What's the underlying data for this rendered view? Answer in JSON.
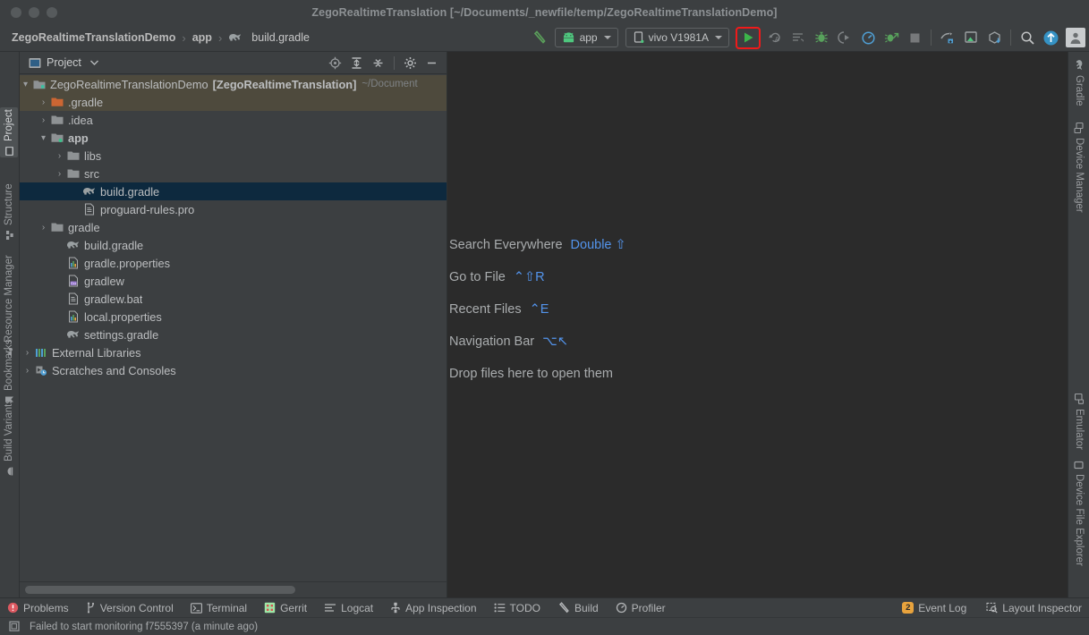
{
  "window": {
    "title": "ZegoRealtimeTranslation [~/Documents/_newfile/temp/ZegoRealtimeTranslationDemo]"
  },
  "breadcrumb": {
    "items": [
      {
        "label": "ZegoRealtimeTranslationDemo",
        "bold": true,
        "icon": ""
      },
      {
        "label": "app",
        "bold": true,
        "icon": ""
      },
      {
        "label": "build.gradle",
        "bold": false,
        "icon": "gradle-elephant-icon"
      }
    ],
    "separator": "›"
  },
  "toolbar": {
    "build_hammer": "build-hammer-icon",
    "module_selector": {
      "label": "app",
      "icon": "android-head-icon"
    },
    "device_selector": {
      "label": "vivo V1981A",
      "icon": "phone-icon"
    },
    "run_button": {
      "label": "Run",
      "icon": "run-play-icon",
      "highlight_color": "#f01a1a",
      "highlighted": true
    },
    "rerun_button": "rerun-icon",
    "apply_changes": "apply-changes-icon",
    "debug_button": "debug-bug-icon",
    "attach_debugger": "attach-debugger-icon",
    "profiler_button": "profiler-gauge-icon",
    "run_with_coverage": "run-coverage-icon",
    "stop_button": "stop-square-icon",
    "sdk_manager": "sdk-manager-icon",
    "avd_manager": "avd-manager-icon",
    "gradle_sync": "gradle-sync-icon",
    "search_button": "search-icon",
    "update_button": "update-arrow-icon",
    "account_button": "user-avatar-icon"
  },
  "left_tool_strip": {
    "top": [
      {
        "label": "Project",
        "icon": "project-icon",
        "active": true
      },
      {
        "label": "Structure",
        "icon": "structure-icon",
        "active": false
      },
      {
        "label": "Resource Manager",
        "icon": "resource-manager-icon",
        "active": false
      }
    ],
    "bottom": [
      {
        "label": "Bookmarks",
        "icon": "bookmark-icon",
        "active": false
      },
      {
        "label": "Build Variants",
        "icon": "build-variants-icon",
        "active": false
      }
    ]
  },
  "right_tool_strip": {
    "top": [
      {
        "label": "Gradle",
        "icon": "gradle-elephant-icon",
        "active": false
      },
      {
        "label": "Device Manager",
        "icon": "device-manager-icon",
        "active": false
      }
    ],
    "bottom": [
      {
        "label": "Emulator",
        "icon": "emulator-icon",
        "active": false
      },
      {
        "label": "Device File Explorer",
        "icon": "device-file-explorer-icon",
        "active": false
      }
    ]
  },
  "project_panel": {
    "title": "Project",
    "title_icon": "project-window-icon",
    "dropdown_icon": "chevron-down-icon",
    "actions": [
      {
        "name": "select-opened-file-icon"
      },
      {
        "name": "expand-all-icon"
      },
      {
        "name": "collapse-all-icon"
      },
      {
        "name": "settings-gear-icon"
      },
      {
        "name": "hide-minimize-icon"
      }
    ],
    "tree": [
      {
        "indent": 0,
        "arrow": "⌄",
        "icon": "module-icon",
        "label": "ZegoRealtimeTranslationDemo",
        "bold": false,
        "suffix_bold": "[ZegoRealtimeTranslation]",
        "suffix_dim": "~/Document",
        "state": "root",
        "squiggle": true
      },
      {
        "indent": 1,
        "arrow": "›",
        "icon": "folder-orange-icon",
        "label": ".gradle",
        "bold": false,
        "state": "highlighted"
      },
      {
        "indent": 1,
        "arrow": "›",
        "icon": "folder-icon",
        "label": ".idea",
        "bold": false,
        "state": "normal"
      },
      {
        "indent": 1,
        "arrow": "⌄",
        "icon": "folder-module-icon",
        "label": "app",
        "bold": true,
        "state": "normal",
        "squiggle": true
      },
      {
        "indent": 2,
        "arrow": "›",
        "icon": "folder-icon",
        "label": "libs",
        "bold": false,
        "state": "normal"
      },
      {
        "indent": 2,
        "arrow": "›",
        "icon": "folder-icon",
        "label": "src",
        "bold": false,
        "state": "normal",
        "squiggle": true
      },
      {
        "indent": 3,
        "arrow": "",
        "icon": "gradle-elephant-icon",
        "label": "build.gradle",
        "bold": false,
        "state": "selected"
      },
      {
        "indent": 3,
        "arrow": "",
        "icon": "text-file-icon",
        "label": "proguard-rules.pro",
        "bold": false,
        "state": "normal"
      },
      {
        "indent": 1,
        "arrow": "›",
        "icon": "folder-icon",
        "label": "gradle",
        "bold": false,
        "state": "normal"
      },
      {
        "indent": 2,
        "arrow": "",
        "icon": "gradle-elephant-icon",
        "label": "build.gradle",
        "bold": false,
        "state": "normal"
      },
      {
        "indent": 2,
        "arrow": "",
        "icon": "properties-file-icon",
        "label": "gradle.properties",
        "bold": false,
        "state": "normal"
      },
      {
        "indent": 2,
        "arrow": "",
        "icon": "shell-script-icon",
        "label": "gradlew",
        "bold": false,
        "state": "normal"
      },
      {
        "indent": 2,
        "arrow": "",
        "icon": "text-file-icon",
        "label": "gradlew.bat",
        "bold": false,
        "state": "normal"
      },
      {
        "indent": 2,
        "arrow": "",
        "icon": "properties-file-icon",
        "label": "local.properties",
        "bold": false,
        "state": "normal"
      },
      {
        "indent": 2,
        "arrow": "",
        "icon": "gradle-elephant-icon",
        "label": "settings.gradle",
        "bold": false,
        "state": "normal"
      },
      {
        "indent": 0,
        "arrow": "›",
        "icon": "external-libraries-icon",
        "label": "External Libraries",
        "bold": false,
        "state": "normal"
      },
      {
        "indent": 0,
        "arrow": "›",
        "icon": "scratches-icon",
        "label": "Scratches and Consoles",
        "bold": false,
        "state": "normal"
      }
    ]
  },
  "editor": {
    "shortcuts": [
      {
        "label": "Search Everywhere",
        "key": "Double ⇧"
      },
      {
        "label": "Go to File",
        "key": "⌃⇧R"
      },
      {
        "label": "Recent Files",
        "key": "⌃E"
      },
      {
        "label": "Navigation Bar",
        "key": "⌥↖"
      },
      {
        "label": "Drop files here to open them",
        "key": ""
      }
    ]
  },
  "bottom_bar": {
    "left": [
      {
        "label": "Problems",
        "icon": "problems-error-icon"
      },
      {
        "label": "Version Control",
        "icon": "version-control-branch-icon"
      },
      {
        "label": "Terminal",
        "icon": "terminal-icon"
      },
      {
        "label": "Gerrit",
        "icon": "gerrit-icon"
      },
      {
        "label": "Logcat",
        "icon": "logcat-icon"
      },
      {
        "label": "App Inspection",
        "icon": "app-inspection-icon"
      },
      {
        "label": "TODO",
        "icon": "todo-list-icon"
      },
      {
        "label": "Build",
        "icon": "build-hammer-icon"
      },
      {
        "label": "Profiler",
        "icon": "profiler-gauge-icon"
      }
    ],
    "right": [
      {
        "label": "Event Log",
        "icon": "event-log-icon",
        "badge": "2"
      },
      {
        "label": "Layout Inspector",
        "icon": "layout-inspector-icon",
        "badge": ""
      }
    ]
  },
  "status_bar": {
    "icon": "memory-indicator-icon",
    "message": "Failed to start monitoring f7555397 (a minute ago)"
  }
}
